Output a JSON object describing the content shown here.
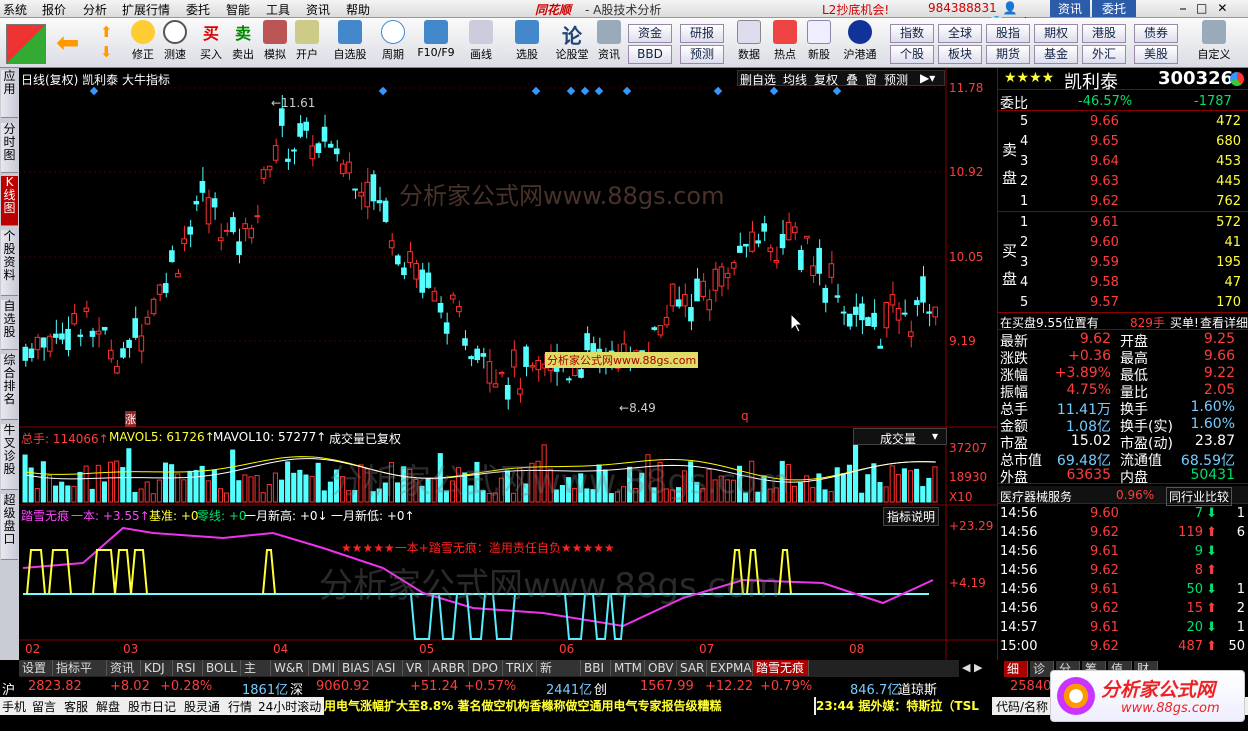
{
  "menu": [
    "系统",
    "报价",
    "分析",
    "扩展行情",
    "委托",
    "智能",
    "工具",
    "资讯",
    "帮助"
  ],
  "title": {
    "logo": "同花顺",
    "sub": "- A股技术分析",
    "promo": "L2抄底机会!",
    "phone": "984388831",
    "zixun": "资讯",
    "weituo": "委托"
  },
  "toolbar": {
    "items": [
      "修正",
      "测速",
      "买入",
      "卖出",
      "模拟",
      "开户",
      "自选股",
      "周期",
      "F10/F9",
      "画线",
      "选股",
      "论股堂",
      "资讯",
      "数据",
      "热点",
      "新股",
      "沪港通"
    ],
    "grid": [
      "资金",
      "研报",
      "指数",
      "全球",
      "股指",
      "期权",
      "债券",
      "BBD",
      "预测",
      "个股",
      "板块",
      "期货",
      "基金",
      "外汇",
      "美股",
      "自定义"
    ]
  },
  "leftnav": [
    "应用",
    "分时图",
    "K线图",
    "个股资料",
    "自选股",
    "综合排名",
    "牛叉诊股",
    "超级盘口"
  ],
  "chart": {
    "header": "日线(复权) 凯利泰 大牛指标",
    "btns": [
      "删自选",
      "均线",
      "复权",
      "叠",
      "窗",
      "预测"
    ],
    "y_labels": [
      "11.78",
      "10.92",
      "10.05",
      "9.19"
    ],
    "high": "11.61",
    "low": "8.49",
    "watermark": "分析家公式网www.88gs.com",
    "wm_small": "分析家公式网www.88gs.com",
    "mark_zhang": "涨",
    "mark_q": "q"
  },
  "volume": {
    "header": "总手: 114066↑",
    "ma5": "MAVOL5: 61726↑",
    "ma10": "MAVOL10: 57277↑",
    "note": "成交量已复权",
    "selector": "成交量",
    "y": [
      "37207",
      "18930",
      "X10"
    ]
  },
  "indicator": {
    "name": "踏雪无痕",
    "v1": "一本: +3.55↑",
    "v2": "基准: +0",
    "v3": "零线: +0",
    "v4": "一月新高: +0↓",
    "v5": "一月新低: +0↑",
    "explain": "指标说明",
    "slogan": "★★★★★一本+踏雪无痕：滥用责任自负★★★★★",
    "y": [
      "+23.29",
      "+4.19"
    ]
  },
  "xaxis": [
    "02",
    "03",
    "05",
    "04",
    "05",
    "06",
    "07",
    "08"
  ],
  "tabs": [
    "设置",
    "指标平台",
    "资讯",
    "KDJ",
    "RSI",
    "BOLL",
    "主力",
    "W&R",
    "DMI",
    "BIAS",
    "ASI",
    "VR",
    "ARBR",
    "DPO",
    "TRIX",
    "新DMA",
    "BBI",
    "MTM",
    "OBV",
    "SAR",
    "EXPMA",
    "踏雪无痕"
  ],
  "stock": {
    "stars": "★★★★",
    "name": "凯利泰",
    "code": "300326",
    "weibi": "委比",
    "weibi_pct": "-46.57%",
    "weibi_val": "-1787",
    "sell_label": "卖盘",
    "buy_label": "买盘",
    "sell": [
      {
        "lv": "5",
        "p": "9.66",
        "v": "472"
      },
      {
        "lv": "4",
        "p": "9.65",
        "v": "680"
      },
      {
        "lv": "3",
        "p": "9.64",
        "v": "453"
      },
      {
        "lv": "2",
        "p": "9.63",
        "v": "445"
      },
      {
        "lv": "1",
        "p": "9.62",
        "v": "762"
      }
    ],
    "buy": [
      {
        "lv": "1",
        "p": "9.61",
        "v": "572"
      },
      {
        "lv": "2",
        "p": "9.60",
        "v": "41"
      },
      {
        "lv": "3",
        "p": "9.59",
        "v": "195"
      },
      {
        "lv": "4",
        "p": "9.58",
        "v": "47"
      },
      {
        "lv": "5",
        "p": "9.57",
        "v": "170"
      }
    ],
    "notice": "在买盘9.55位置有",
    "notice_amt": "829手",
    "notice_act": "买单!",
    "notice_link": "查看详细",
    "stats": [
      [
        "最新",
        "9.62",
        "开盘",
        "9.25"
      ],
      [
        "涨跌",
        "+0.36",
        "最高",
        "9.66"
      ],
      [
        "涨幅",
        "+3.89%",
        "最低",
        "9.22"
      ],
      [
        "振幅",
        "4.75%",
        "量比",
        "2.05"
      ],
      [
        "总手",
        "11.41万",
        "换手",
        "1.60%"
      ],
      [
        "金额",
        "1.08亿",
        "换手(实)",
        "1.60%"
      ],
      [
        "市盈",
        "15.02",
        "市盈(动)",
        "23.87"
      ],
      [
        "总市值",
        "69.48亿",
        "流通值",
        "68.59亿"
      ],
      [
        "外盘",
        "63635",
        "内盘",
        "50431"
      ]
    ],
    "industry": "医疗器械服务",
    "industry_pct": "0.96%",
    "industry_btn": "同行业比较",
    "ticks": [
      [
        "14:56",
        "9.60",
        "7",
        "",
        "1"
      ],
      [
        "14:56",
        "9.62",
        "119",
        "",
        "6"
      ],
      [
        "14:56",
        "9.61",
        "9",
        "",
        ""
      ],
      [
        "14:56",
        "9.62",
        "8",
        "",
        ""
      ],
      [
        "14:56",
        "9.61",
        "50",
        "",
        "1"
      ],
      [
        "14:56",
        "9.62",
        "15",
        "",
        "2"
      ],
      [
        "14:57",
        "9.61",
        "20",
        "",
        "1"
      ],
      [
        "15:00",
        "9.62",
        "487",
        "",
        "50"
      ]
    ],
    "ticktabs": [
      "细",
      "诊",
      "分",
      "筹",
      "值",
      "财"
    ]
  },
  "status": {
    "sh_label": "沪",
    "sh": "2823.82",
    "sh_chg": "+8.02",
    "sh_pct": "+0.28%",
    "sh_amt": "1861亿",
    "sz_label": "深",
    "sz": "9060.92",
    "sz_chg": "+51.24",
    "sz_pct": "+0.57%",
    "sz_amt": "2441亿",
    "cy_label": "创",
    "cy": "1567.99",
    "cy_chg": "+12.22",
    "cy_pct": "+0.79%",
    "cy_amt": "846.7亿",
    "dj_label": "道琼斯",
    "dj": "25840"
  },
  "ticker": {
    "items": [
      "手机",
      "留言",
      "客服",
      "解盘",
      "股市日记",
      "股灵通",
      "行情",
      "24小时滚动"
    ],
    "news": "用电气涨幅扩大至8.8% 著名做空机构香橼称做空通用电气专家报告级糟糕",
    "time": "23:44",
    "news2": "据外媒：特斯拉（TSL",
    "code": "代码/名称"
  },
  "logo_text": "分析家公式网",
  "logo_url": "www.88gs.com"
}
